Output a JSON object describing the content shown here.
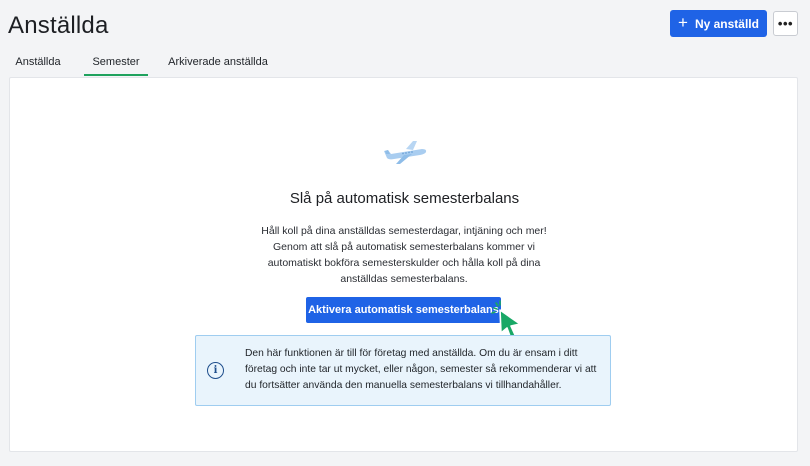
{
  "header": {
    "title": "Anställda",
    "new_employee_label": "Ny anställd",
    "new_employee_icon": "plus-icon",
    "more_label": "•••",
    "more_icon": "more-horizontal-icon"
  },
  "tabs": [
    {
      "label": "Anställda",
      "active": false
    },
    {
      "label": "Semester",
      "active": true
    },
    {
      "label": "Arkiverade anställda",
      "active": false
    }
  ],
  "main": {
    "illustration": "airplane-icon",
    "heading": "Slå på automatisk semesterbalans",
    "description": "Håll koll på dina anställdas semesterdagar, intjäning och mer! Genom att slå på automatisk semesterbalans kommer vi automatiskt bokföra semesterskulder och hålla koll på dina anställdas semesterbalans.",
    "cta_label": "Aktivera automatisk semesterbalans",
    "info_icon": "info-icon",
    "info_text": "Den här funktionen är till för företag med anställda. Om du är ensam i ditt företag och inte tar ut mycket, eller någon, semester så rekommenderar vi att du fortsätter använda den manuella semesterbalans vi tillhandahåller."
  },
  "colors": {
    "accent": "#1f63e6",
    "tab_indicator": "#1fa25d",
    "info_bg": "#e9f4fc",
    "info_border": "#9fcdf0",
    "cursor": "#19a866"
  }
}
